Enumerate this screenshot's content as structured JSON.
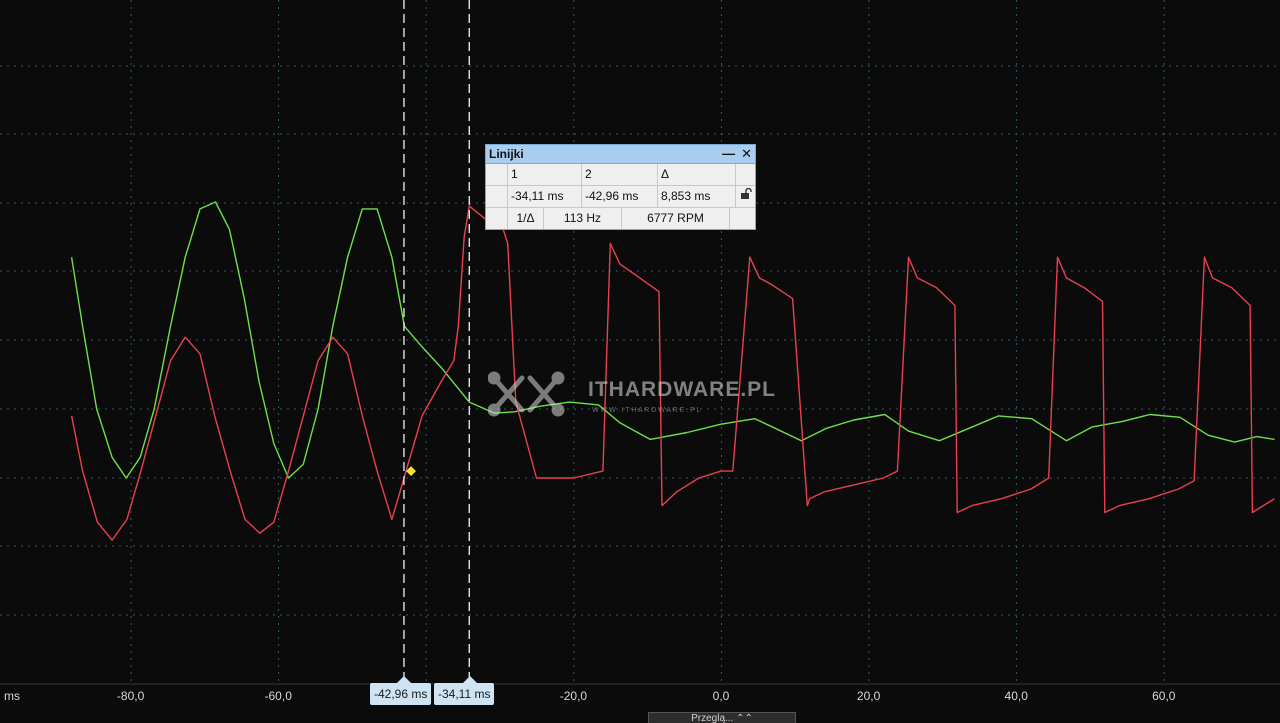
{
  "chart_data": {
    "type": "line",
    "x_unit": "ms",
    "x_range": [
      -88,
      75
    ],
    "x_tick_labels": [
      "ms",
      "-80,0",
      "-60,0",
      "-20,0",
      "0,0",
      "20,0",
      "40,0",
      "60,0"
    ],
    "x_tick_values": [
      null,
      -80,
      -60,
      -20,
      0,
      20,
      40,
      60
    ],
    "grid": true,
    "series": [
      {
        "color": "#6ee04a",
        "x": [
          -88,
          -86.5,
          -84.6,
          -82.5,
          -80.6,
          -78.7,
          -76.8,
          -74.6,
          -72.6,
          -70.6,
          -68.5,
          -66.6,
          -64.6,
          -62.6,
          -60.6,
          -58.6,
          -56.6,
          -54.6,
          -52.6,
          -50.6,
          -48.6,
          -46.6,
          -44.6,
          -42.9,
          -40.5,
          -37.9,
          -34.1,
          -30.7,
          -28.0,
          -24.5,
          -20.5,
          -16.6,
          -13.7,
          -9.6,
          -4.6,
          0.0,
          4.6,
          10.9,
          14.3,
          18.0,
          22.2,
          25.4,
          29.6,
          33.6,
          37.6,
          42.1,
          46.8,
          50.3,
          54.4,
          58.1,
          62.2,
          66.0,
          69.6,
          72.6,
          75
        ],
        "y": [
          0.6,
          0.1,
          -0.5,
          -0.85,
          -1.0,
          -0.85,
          -0.5,
          0.1,
          0.6,
          0.95,
          1.0,
          0.8,
          0.3,
          -0.3,
          -0.75,
          -1.0,
          -0.9,
          -0.5,
          0.1,
          0.6,
          0.95,
          0.95,
          0.6,
          0.1,
          -0.05,
          -0.2,
          -0.45,
          -0.53,
          -0.52,
          -0.48,
          -0.45,
          -0.47,
          -0.6,
          -0.72,
          -0.67,
          -0.61,
          -0.57,
          -0.73,
          -0.64,
          -0.58,
          -0.54,
          -0.66,
          -0.73,
          -0.64,
          -0.55,
          -0.57,
          -0.73,
          -0.63,
          -0.59,
          -0.54,
          -0.56,
          -0.69,
          -0.74,
          -0.7,
          -0.72
        ]
      },
      {
        "color": "#e8404e",
        "x": [
          -88,
          -86.5,
          -84.5,
          -82.5,
          -80.5,
          -78.6,
          -76.6,
          -74.6,
          -72.6,
          -70.6,
          -68.6,
          -66.5,
          -64.5,
          -62.5,
          -60.6,
          -58.6,
          -56.6,
          -54.6,
          -52.6,
          -50.6,
          -48.6,
          -46.6,
          -44.6,
          -42.96,
          -40.5,
          -37.9,
          -36.2,
          -35.6,
          -34.8,
          -34.11,
          -32.0,
          -29.5,
          -28.9,
          -27.8,
          -25.0,
          -20.0,
          -16.0,
          -15.0,
          -13.7,
          -11.0,
          -8.4,
          -8.0,
          -6.0,
          -3.0,
          0.0,
          1.6,
          3.9,
          5.2,
          6.9,
          9.7,
          11.7,
          12.0,
          14.0,
          18.0,
          22.0,
          23.9,
          25.4,
          26.6,
          29.2,
          31.7,
          32.0,
          34.0,
          38.0,
          42.0,
          44.4,
          45.6,
          46.8,
          49.2,
          51.7,
          52.0,
          54.0,
          58.0,
          62.0,
          64.1,
          65.5,
          66.6,
          69.2,
          71.7,
          72.0,
          75.0
        ],
        "y": [
          -0.55,
          -0.95,
          -1.32,
          -1.45,
          -1.3,
          -0.95,
          -0.55,
          -0.15,
          0.02,
          -0.1,
          -0.55,
          -0.95,
          -1.3,
          -1.4,
          -1.32,
          -0.95,
          -0.55,
          -0.15,
          0.02,
          -0.1,
          -0.55,
          -0.95,
          -1.3,
          -1.0,
          -0.55,
          -0.3,
          -0.15,
          0.1,
          0.75,
          0.97,
          0.88,
          0.8,
          0.7,
          -0.45,
          -1.0,
          -1.0,
          -0.95,
          0.7,
          0.55,
          0.45,
          0.35,
          -1.2,
          -1.1,
          -1.0,
          -0.95,
          -0.95,
          0.6,
          0.45,
          0.4,
          0.3,
          -1.2,
          -1.15,
          -1.1,
          -1.05,
          -1.0,
          -0.95,
          0.6,
          0.45,
          0.38,
          0.25,
          -1.25,
          -1.2,
          -1.15,
          -1.08,
          -1.0,
          0.6,
          0.45,
          0.38,
          0.28,
          -1.25,
          -1.2,
          -1.15,
          -1.08,
          -1.02,
          0.6,
          0.45,
          0.38,
          0.25,
          -1.25,
          -1.15
        ]
      }
    ],
    "cursors": [
      {
        "label": "-42,96 ms",
        "x": -42.96
      },
      {
        "label": "-34,11 ms",
        "x": -34.11
      }
    ],
    "marker": {
      "x": -42.0,
      "y": -0.95,
      "color": "#f5e52a"
    }
  },
  "rulers_panel": {
    "title": "Linijki",
    "minimize": "—",
    "close": "✕",
    "headers": [
      "1",
      "2",
      "Δ"
    ],
    "values": [
      "-34,11 ms",
      "-42,96 ms",
      "8,853 ms"
    ],
    "lock_icon": "unlocked-icon",
    "inverse_label": "1/Δ",
    "frequency": "113 Hz",
    "rpm": "6777 RPM"
  },
  "watermark": {
    "logo_icon": "ithardware-logo-icon",
    "text": "ITHARDWARE.PL",
    "url": "W W W . I T H A R D W A R E . P L"
  },
  "bottom_tab": {
    "label": "Przeglą... ⌃⌃"
  }
}
